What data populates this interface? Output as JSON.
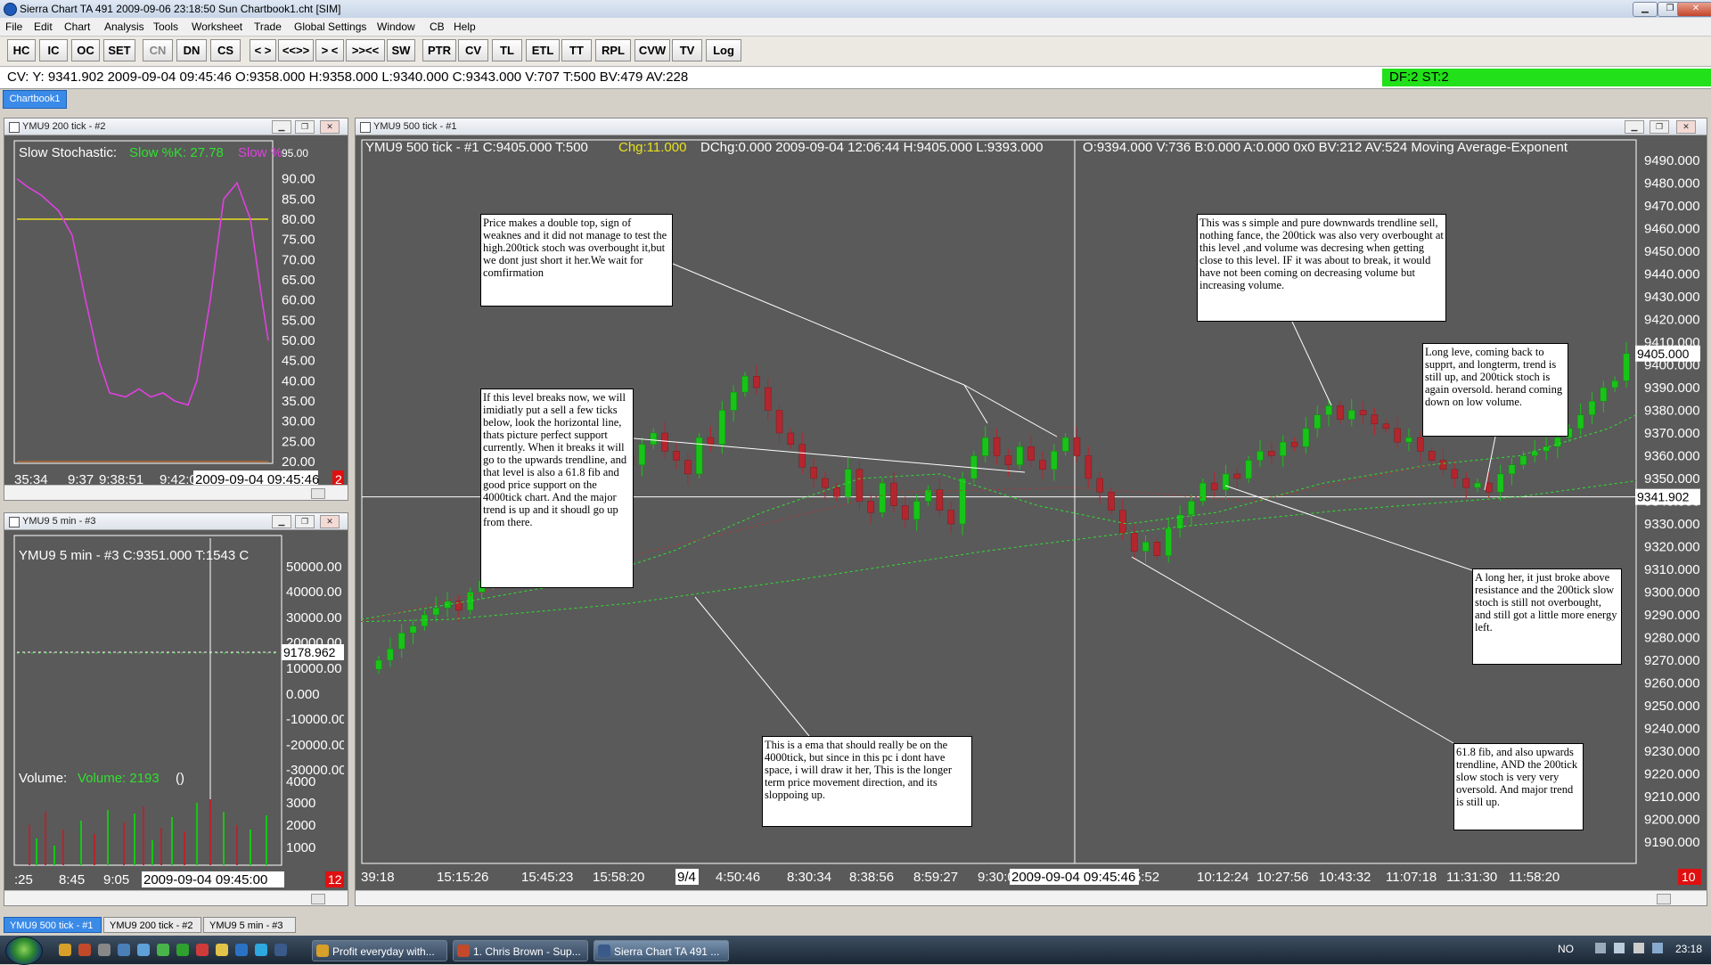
{
  "app": {
    "title": "Sierra Chart TA 491   2009-09-06  23:18:50  Sun   Chartbook1.cht [SIM]"
  },
  "menu": [
    "File",
    "Edit",
    "Chart",
    "Analysis",
    "Tools",
    "Worksheet",
    "Trade",
    "Global Settings",
    "Window",
    "CB",
    "Help"
  ],
  "toolbar": [
    "HC",
    "IC",
    "OC",
    "SET",
    "CN",
    "DN",
    "CS",
    "< >",
    "<<>>",
    "> <",
    ">><<",
    "SW",
    "PTR",
    "CV",
    "TL",
    "ETL",
    "TT",
    "RPL",
    "CVW",
    "TV",
    "Log"
  ],
  "cv_bar": {
    "text": "CV: Y: 9341.902  2009-09-04  09:45:46  O:9358.000  H:9358.000  L:9340.000  C:9343.000  V:707  T:500  BV:479  AV:228",
    "status": "DF:2  ST:2"
  },
  "chartbook_tab": "Chartbook1",
  "win200": {
    "title": "YMU9  200 tick - #2",
    "study_label": "Slow Stochastic:",
    "k_label": "Slow %K: 27.78",
    "d_label": "Slow %",
    "top_label": "95.00",
    "y_labels": [
      "90.00",
      "85.00",
      "80.00",
      "75.00",
      "70.00",
      "65.00",
      "60.00",
      "55.00",
      "50.00",
      "45.00",
      "40.00",
      "35.00",
      "30.00",
      "25.00",
      "20.00"
    ],
    "x_labels": [
      "35:34",
      "9:37",
      "9:38:51",
      "9:42:0"
    ],
    "cursor_time": "2009-09-04  09:45:46",
    "red_box": "2"
  },
  "win5": {
    "title": "YMU9  5 min  - #3",
    "info": "YMU9  5 min  - #3  C:9351.000  T:1543  C",
    "y_labels": [
      "50000.00",
      "40000.00",
      "30000.00",
      "20000.00",
      "10000.00",
      "0.000",
      "-10000.00",
      "-20000.00",
      "-30000.00"
    ],
    "price_box": "9178.962",
    "volume_label": "Volume:",
    "volume_value": "Volume: 2193",
    "volume_paren": "()",
    "vol_labels": [
      "4000",
      "3000",
      "2000",
      "1000"
    ],
    "x_labels": [
      ":25",
      "8:45",
      "9:05"
    ],
    "cursor_time": "2009-09-04  09:45:00",
    "red_box": "12"
  },
  "main": {
    "title": "YMU9  500 tick - #1",
    "info_a": "YMU9  500 tick - #1  C:9405.000  T:500",
    "chg": "Chg:11.000",
    "info_b": "DChg:0.000  2009-09-04  12:06:44  H:9405.000  L:9393.000",
    "info_c": "O:9394.000  V:736  B:0.000  A:0.000  0x0    BV:212  AV:524  Moving Average-Exponent",
    "y_labels": [
      "9490.000",
      "9480.000",
      "9470.000",
      "9460.000",
      "9450.000",
      "9440.000",
      "9430.000",
      "9420.000",
      "9410.000",
      "9400.000",
      "9390.000",
      "9380.000",
      "9370.000",
      "9360.000",
      "9350.000",
      "9340.000",
      "9330.000",
      "9320.000",
      "9310.000",
      "9300.000",
      "9290.000",
      "9280.000",
      "9270.000",
      "9260.000",
      "9250.000",
      "9240.000",
      "9230.000",
      "9220.000",
      "9210.000",
      "9200.000",
      "9190.000"
    ],
    "last_price": "9405.000",
    "cursor_price": "9341.902",
    "x_labels": [
      "39:18",
      "15:15:26",
      "15:45:23",
      "15:58:20",
      "9/4",
      "4:50:46",
      "8:30:34",
      "8:38:56",
      "8:59:27",
      "9:30:02",
      "9:35:2",
      "9:55:52",
      "10:12:24",
      "10:27:56",
      "10:43:32",
      "11:07:18",
      "11:31:30",
      "11:58:20"
    ],
    "cursor_time": "2009-09-04  09:45:46",
    "red_box": "10",
    "annotations": [
      "Price makes a double top, sign of weaknes and it did not manage to test the high.200tick stoch was overbought it,but we dont just short it her.We wait for comfirmation",
      "If this level breaks now, we will imidiatly put a sell a few ticks below, look the horizontal line, thats picture perfect support currently. When it breaks it will go to the upwards trendline, and that level is also a 61.8 fib and good price support on the 4000tick chart. And the major trend is up and it shoudl go up from there.",
      "This is a ema that should really be on the 4000tick, but since in this pc i dont have space, i will draw it her, This is the longer term price movement direction, and its sloppoing up.",
      "This was s simple and pure downwards trendline sell, nothing fance, the 200tick was also very overbought at this level ,and volume was decresing when getting close to this level. IF it was about to break, it would have not been coming on decreasing volume but increasing volume.",
      "Long leve, coming back to supprt, and longterm, trend is still up, and 200tick stoch is again oversold. herand coming down on low volume.",
      "A long her, it just broke above resistance and the 200tick slow stoch is still not overbought, and still got a little more energy left.",
      "61.8 fib, and also upwards trendline, AND the 200tick slow stoch is very very oversold. And major trend is still up."
    ]
  },
  "bottom_tabs": [
    "YMU9  500 tick - #1",
    "YMU9  200 tick - #2",
    "YMU9  5 min  - #3"
  ],
  "taskbar": {
    "items": [
      "Profit everyday with...",
      "1. Chris Brown - Sup...",
      "Sierra Chart TA 491  ..."
    ],
    "lang": "NO",
    "clock": "23:18"
  },
  "colors": {
    "chart_bg": "#5a5a5a",
    "up_candle": "#18c418",
    "down_candle": "#b3262e",
    "stoch_k": "#e040e0",
    "stoch_level": "#e8e020",
    "ema": "#2ee02e",
    "info_green": "#30e030",
    "chg_yellow": "#e8e020"
  }
}
